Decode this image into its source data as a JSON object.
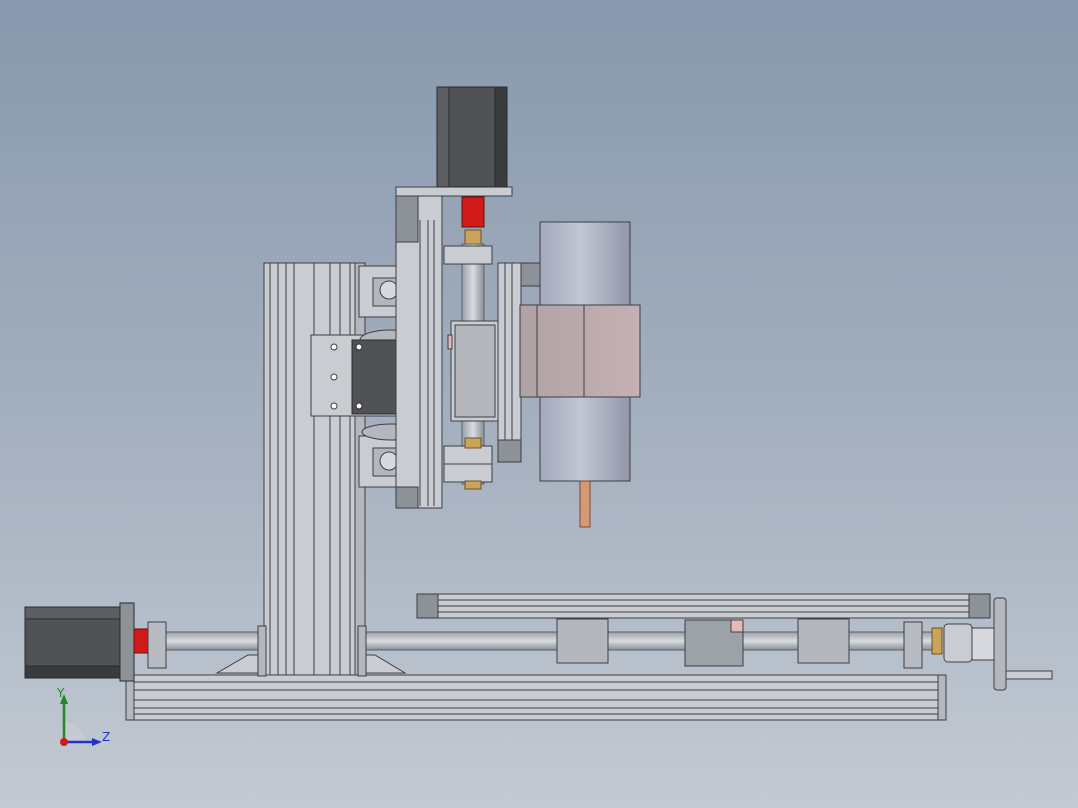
{
  "viewport": {
    "background_top": "#8799ad",
    "background_bottom": "#c3cad3"
  },
  "triad": {
    "y_label": "Y",
    "z_label": "Z",
    "y_color": "#1f8a1f",
    "z_color": "#1f35c8",
    "x_color": "#d21a1a"
  },
  "colors": {
    "aluminum": "#c9ccd1",
    "aluminum_dark": "#8d9198",
    "motor_body": "#505255",
    "coupler": "#d11a1a",
    "spindle": "#aeb3c6",
    "spindle_clamp": "#b7a8ab",
    "brass": "#c9a45a",
    "bit": "#d49a78"
  }
}
